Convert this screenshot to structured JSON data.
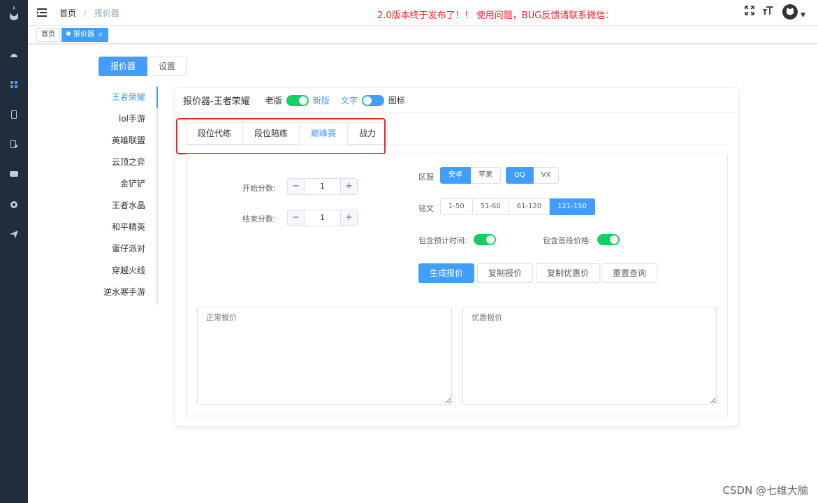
{
  "sidebar": {
    "icons": [
      "dashboard-icon",
      "grid-icon",
      "phone-icon",
      "document-icon",
      "chat-icon",
      "gear-icon",
      "send-icon"
    ]
  },
  "header": {
    "breadcrumb_home": "首页",
    "breadcrumb_sep": "/",
    "breadcrumb_current": "报价器",
    "announcement": "2.0版本终于发布了！！ 使用问题，BUG反馈请联系微信："
  },
  "tags": {
    "home": "首页",
    "current": "报价器",
    "close": "×"
  },
  "top_tabs": {
    "quoter": "报价器",
    "settings": "设置"
  },
  "games": [
    "王者荣耀",
    "lol手游",
    "英雄联盟",
    "云顶之弈",
    "金铲铲",
    "王者水晶",
    "和平精英",
    "蛋仔派对",
    "穿越火线",
    "逆水寒手游"
  ],
  "card": {
    "title": "报价器-王者荣耀",
    "old_label": "老版",
    "new_label": "新版",
    "text_label": "文字",
    "icon_label": "图标"
  },
  "subtabs": [
    "段位代练",
    "段位陪练",
    "巅峰赛",
    "战力"
  ],
  "form": {
    "start_label": "开始分数:",
    "start_value": "1",
    "end_label": "结束分数:",
    "end_value": "1",
    "minus": "−",
    "plus": "+",
    "region_label": "区服",
    "region_platform": [
      "安卓",
      "苹果"
    ],
    "region_account": [
      "QQ",
      "VX"
    ],
    "inscription_label": "铭文",
    "inscriptions": [
      "1-50",
      "51-60",
      "61-120",
      "121-150"
    ],
    "include_time_label": "包含预计时间:",
    "include_first_label": "包含首段价格:"
  },
  "actions": {
    "generate": "生成报价",
    "copy": "复制报价",
    "copy_discount": "复制优惠价",
    "reset": "重置查询"
  },
  "textareas": {
    "normal_placeholder": "正常报价",
    "discount_placeholder": "优惠报价"
  },
  "watermark": "CSDN @七维大脑",
  "colors": {
    "primary": "#409eff",
    "switch_on": "#13ce66",
    "alert": "#f5222d",
    "sidebar": "#1f2d3d"
  }
}
